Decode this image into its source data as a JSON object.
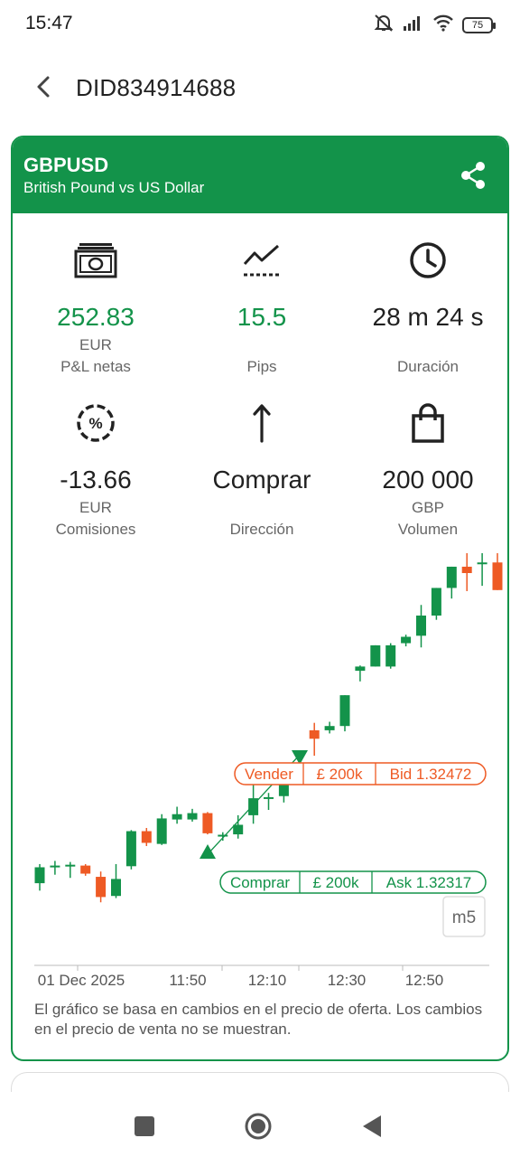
{
  "status_bar": {
    "time": "15:47",
    "battery": "75",
    "icons": [
      "mute-icon",
      "signal-icon",
      "wifi-icon",
      "battery-icon"
    ]
  },
  "app_bar": {
    "title": "DID834914688",
    "back_icon": "back-arrow-icon"
  },
  "instrument": {
    "symbol": "GBPUSD",
    "description": "British Pound vs US Dollar",
    "share_icon": "share-icon"
  },
  "stats": [
    {
      "icon": "money-icon",
      "value": "252.83",
      "unit": "EUR",
      "label": "P&L netas",
      "color": "#13934a"
    },
    {
      "icon": "trend-line-icon",
      "value": "15.5",
      "unit": "",
      "label": "Pips",
      "color": "#13934a"
    },
    {
      "icon": "clock-icon",
      "value": "28 m 24 s",
      "unit": "",
      "label": "Duración",
      "color": "#212121"
    },
    {
      "icon": "percent-icon",
      "value": "-13.66",
      "unit": "EUR",
      "label": "Comisiones",
      "color": "#212121"
    },
    {
      "icon": "arrow-up-icon",
      "value": "Comprar",
      "unit": "",
      "label": "Dirección",
      "color": "#212121"
    },
    {
      "icon": "shopping-bag-icon",
      "value": "200 000",
      "unit": "GBP",
      "label": "Volumen",
      "color": "#212121"
    }
  ],
  "chart_data": {
    "type": "candlestick",
    "timeframe": "m5",
    "x_labels": [
      "01 Dec 2025",
      "11:50",
      "12:10",
      "12:30",
      "12:50"
    ],
    "candles": [
      {
        "o": 34.0,
        "h": 43.0,
        "l": 30.5,
        "c": 41.5
      },
      {
        "o": 41.5,
        "h": 44.5,
        "l": 38.0,
        "c": 42.3
      },
      {
        "o": 42.3,
        "h": 44.0,
        "l": 36.5,
        "c": 42.7
      },
      {
        "o": 42.3,
        "h": 43.0,
        "l": 37.5,
        "c": 38.5
      },
      {
        "o": 37.0,
        "h": 39.5,
        "l": 25.0,
        "c": 27.5
      },
      {
        "o": 28.0,
        "h": 43.0,
        "l": 27.0,
        "c": 36.0
      },
      {
        "o": 42.0,
        "h": 59.0,
        "l": 40.5,
        "c": 58.5
      },
      {
        "o": 58.5,
        "h": 60.0,
        "l": 51.5,
        "c": 53.0
      },
      {
        "o": 52.5,
        "h": 66.5,
        "l": 52.0,
        "c": 64.5
      },
      {
        "o": 64.0,
        "h": 70.0,
        "l": 62.0,
        "c": 66.5
      },
      {
        "o": 64.0,
        "h": 69.0,
        "l": 63.0,
        "c": 67.0
      },
      {
        "o": 67.0,
        "h": 67.5,
        "l": 57.0,
        "c": 57.5
      },
      {
        "o": 56.5,
        "h": 58.0,
        "l": 54.0,
        "c": 56.8
      },
      {
        "o": 57.0,
        "h": 66.0,
        "l": 55.0,
        "c": 61.5
      },
      {
        "o": 66.0,
        "h": 84.0,
        "l": 62.0,
        "c": 74.0
      },
      {
        "o": 74.0,
        "h": 76.5,
        "l": 68.5,
        "c": 74.5
      },
      {
        "o": 75.0,
        "h": 86.0,
        "l": 72.0,
        "c": 84.0
      },
      {
        "o": 88.0,
        "h": 95.0,
        "l": 81.5,
        "c": 87.5
      },
      {
        "o": 106.0,
        "h": 109.5,
        "l": 94.0,
        "c": 102.0
      },
      {
        "o": 106.0,
        "h": 110.0,
        "l": 104.5,
        "c": 108.0
      },
      {
        "o": 108.0,
        "h": 111.5,
        "l": 105.5,
        "c": 122.5
      },
      {
        "o": 134.0,
        "h": 136.5,
        "l": 129.0,
        "c": 136.0
      },
      {
        "o": 136.0,
        "h": 137.0,
        "l": 146.0,
        "c": 146.0
      },
      {
        "o": 136.0,
        "h": 147.0,
        "l": 135.0,
        "c": 146.0
      },
      {
        "o": 147.0,
        "h": 151.0,
        "l": 145.5,
        "c": 150.0
      },
      {
        "o": 150.5,
        "h": 165.0,
        "l": 145.0,
        "c": 160.0
      },
      {
        "o": 160.0,
        "h": 173.0,
        "l": 158.0,
        "c": 173.0
      },
      {
        "o": 173.0,
        "h": 181.0,
        "l": 168.0,
        "c": 183.0
      },
      {
        "o": 183.0,
        "h": 190.0,
        "l": 171.5,
        "c": 180.0
      },
      {
        "o": 185.0,
        "h": 190.0,
        "l": 174.0,
        "c": 185.0
      },
      {
        "o": 185.0,
        "h": 195.0,
        "l": 172.0,
        "c": 172.0
      },
      {
        "o": 176.0,
        "h": 182.0,
        "l": 164.0,
        "c": 166.0
      },
      {
        "o": 165.0,
        "h": 168.0,
        "l": 155.0,
        "c": 157.0
      }
    ],
    "sell_tag": {
      "side": "Vender",
      "amount": "£ 200k",
      "price": "Bid 1.32472"
    },
    "buy_tag": {
      "side": "Comprar",
      "amount": "£ 200k",
      "price": "Ask 1.32317"
    },
    "colors": {
      "up": "#13934a",
      "down": "#ee5a24"
    }
  },
  "disclaimer": "El gráfico se basa en cambios en el precio de oferta. Los cambios en el precio de venta no se muestran.",
  "nav_bar": {
    "icons": [
      "recents-icon",
      "home-icon",
      "back-icon"
    ]
  }
}
